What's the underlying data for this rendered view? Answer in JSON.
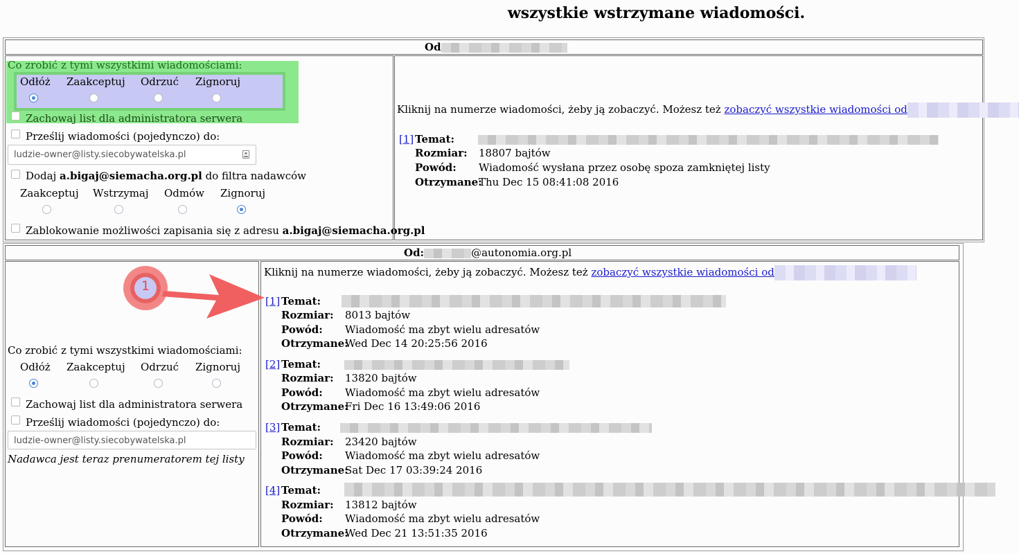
{
  "page_title": "wszystkie wstrzymane wiadomości.",
  "sender1": {
    "header_prefix": "Od",
    "actions_label": "Co zrobić z tymi wszystkimi wiadomościami:",
    "actions": [
      "Odłóż",
      "Zaakceptuj",
      "Odrzuć",
      "Zignoruj"
    ],
    "selected_action": "Odłóż",
    "keep_admin_label": "Zachowaj list dla administratora serwera",
    "forward_label": "Prześlij wiadomości (pojedynczo) do:",
    "forward_value": "ludzie-owner@listy.siecobywatelska.pl",
    "add_filter_prefix": "Dodaj ",
    "add_filter_email": "a.bigaj@siemacha.org.pl",
    "add_filter_suffix": " do filtra nadawców",
    "filter_actions": [
      "Zaakceptuj",
      "Wstrzymaj",
      "Odmów",
      "Zignoruj"
    ],
    "selected_filter_action": "Zignoruj",
    "block_label_prefix": "Zablokowanie możliwości zapisania się z adresu ",
    "block_email": "a.bigaj@siemacha.org.pl",
    "click_info": "Kliknij na numerze wiadomości, żeby ją zobaczyć. Możesz też ",
    "view_all_link": "zobaczyć wszystkie wiadomości od",
    "messages": [
      {
        "num": "[1]",
        "size": "18807 bajtów",
        "reason": "Wiadomość wysłana przez osobę spoza zamkniętej listy",
        "received": "Thu Dec 15 08:41:08 2016"
      }
    ]
  },
  "sender2": {
    "header_prefix": "Od:",
    "header_domain": "@autonomia.org.pl",
    "actions_label": "Co zrobić z tymi wszystkimi wiadomościami:",
    "actions": [
      "Odłóż",
      "Zaakceptuj",
      "Odrzuć",
      "Zignoruj"
    ],
    "selected_action": "Odłóż",
    "keep_admin_label": "Zachowaj list dla administratora serwera",
    "forward_label": "Prześlij wiadomości (pojedynczo) do:",
    "forward_value": "ludzie-owner@listy.siecobywatelska.pl",
    "subscriber_note": "Nadawca jest teraz prenumeratorem tej listy",
    "click_info": "Kliknij na numerze wiadomości, żeby ją zobaczyć. Możesz też ",
    "view_all_link": "zobaczyć wszystkie wiadomości od",
    "messages": [
      {
        "num": "[1]",
        "size": "8013 bajtów",
        "reason": "Wiadomość ma zbyt wielu adresatów",
        "received": "Wed Dec 14 20:25:56 2016"
      },
      {
        "num": "[2]",
        "size": "13820 bajtów",
        "reason": "Wiadomość ma zbyt wielu adresatów",
        "received": "Fri Dec 16 13:49:06 2016"
      },
      {
        "num": "[3]",
        "size": "23420 bajtów",
        "reason": "Wiadomość ma zbyt wielu adresatów",
        "received": "Sat Dec 17 03:39:24 2016"
      },
      {
        "num": "[4]",
        "size": "13812 bajtów",
        "reason": "Wiadomość ma zbyt wielu adresatów",
        "received": "Wed Dec 21 13:51:35 2016"
      }
    ]
  },
  "field_labels": {
    "subject": "Temat:",
    "size": "Rozmiar:",
    "reason": "Powód:",
    "received": "Otrzymane:"
  },
  "annotation": {
    "step": "1"
  },
  "colors": {
    "highlight_fill": "#c8c8f4",
    "highlight_border": "#8ce88c",
    "annotation": "#f05a5a",
    "link": "#1a1acc"
  }
}
